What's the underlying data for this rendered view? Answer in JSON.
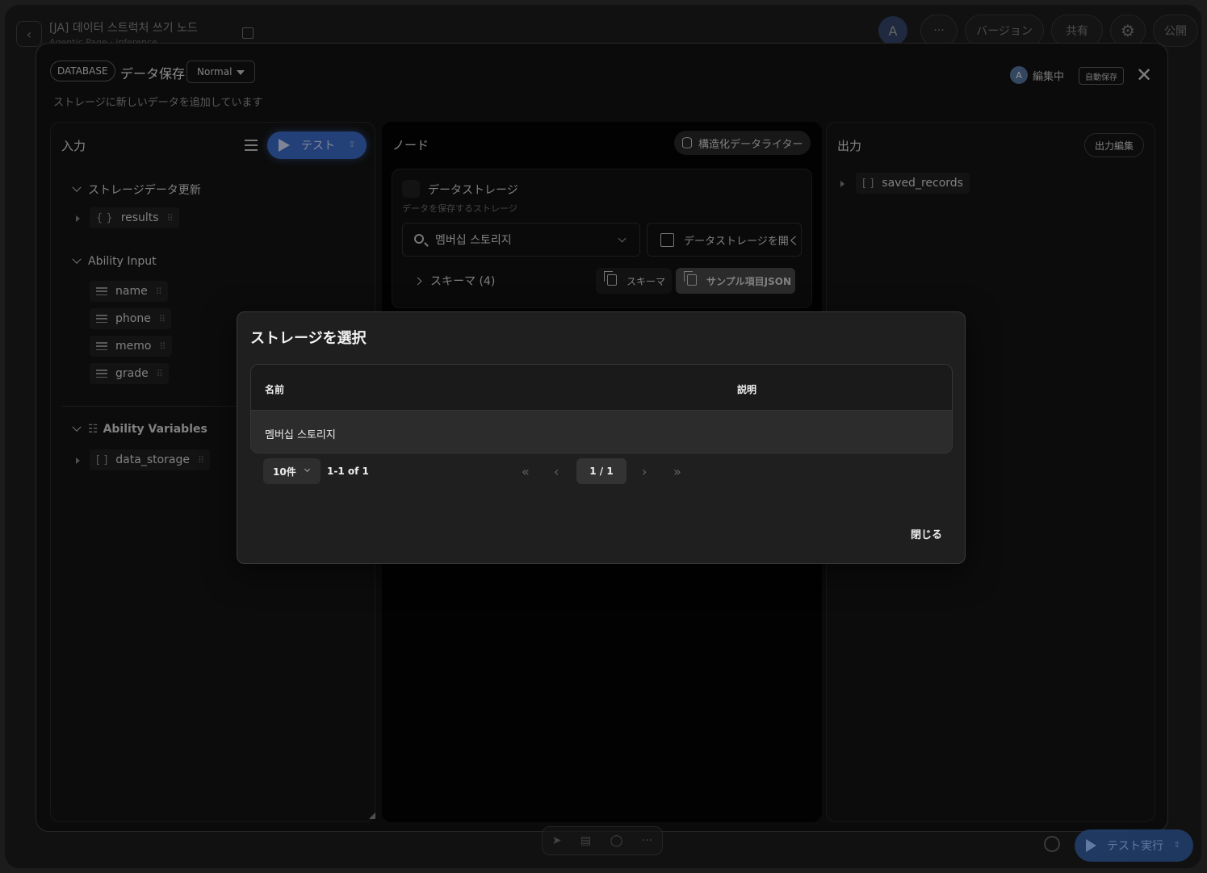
{
  "topbar": {
    "title": "[JA] 데이터 스트럭처 쓰기 노드",
    "subtitle": "Agentic Page · inference",
    "avatar": "A",
    "more": "···",
    "version": "バージョン",
    "share": "共有",
    "publish": "公開"
  },
  "panel": {
    "tag": "DATABASE",
    "title": "データ保存",
    "mode": "Normal",
    "description": "ストレージに新しいデータを追加しています",
    "editing_avatar": "A",
    "editing_label": "編集中",
    "autosave": "自動保存"
  },
  "input": {
    "header": "入力",
    "test_label": "テスト",
    "test_kbd": "⇧",
    "section1": "ストレージデータ更新",
    "section1_items": [
      {
        "label": "results"
      }
    ],
    "section2": "Ability Input",
    "section2_items": [
      {
        "label": "name"
      },
      {
        "label": "phone"
      },
      {
        "label": "memo"
      },
      {
        "label": "grade"
      }
    ],
    "section3": "Ability Variables",
    "section3_items": [
      {
        "label": "data_storage"
      }
    ]
  },
  "node": {
    "header": "ノード",
    "badge": "構造化データライター",
    "card_title": "データストレージ",
    "card_subtitle": "データを保存するストレージ",
    "selected_storage": "멤버십 스토리지",
    "open_label": "データストレージを開く",
    "schema_toggle": "スキーマ (4)",
    "copy_schema": "スキーマ",
    "copy_sample": "サンプル項目JSON"
  },
  "output": {
    "header": "出力",
    "edit_label": "出力編集",
    "items": [
      {
        "label": "saved_records"
      }
    ]
  },
  "bottom": {
    "run_label": "テスト実行",
    "run_kbd": "⇧"
  },
  "dialog": {
    "title": "ストレージを選択",
    "columns": {
      "name": "名前",
      "description": "説明"
    },
    "rows": [
      {
        "name": "멤버십 스토리지",
        "description": ""
      }
    ],
    "page_size": "10件",
    "range": "1-1 of 1",
    "page": "1 / 1",
    "close_label": "閉じる"
  },
  "colors": {
    "accent": "#3e6fd1",
    "background": "#111111",
    "dialog": "#1f1f1f",
    "selected_row": "#2c2c2c"
  }
}
